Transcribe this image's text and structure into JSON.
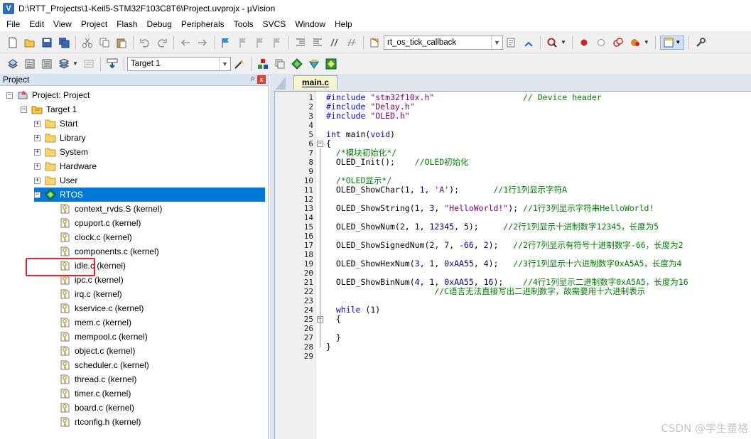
{
  "window": {
    "title": "D:\\RTT_Projects\\1-Keil5-STM32F103C8T6\\Project.uvprojx - µVision",
    "app_icon": "V"
  },
  "menu": [
    "File",
    "Edit",
    "View",
    "Project",
    "Flash",
    "Debug",
    "Peripherals",
    "Tools",
    "SVCS",
    "Window",
    "Help"
  ],
  "toolbar": {
    "find_combo": "rt_os_tick_callback",
    "target_combo": "Target 1"
  },
  "project_panel": {
    "title": "Project",
    "pin": "ᵖ",
    "close": "x",
    "tree": [
      {
        "label": "Project: Project",
        "icon": "project-icon",
        "expander": "−"
      },
      {
        "label": "Target 1",
        "icon": "target-folder-icon",
        "expander": "−"
      },
      {
        "label": "Start",
        "icon": "folder-icon",
        "expander": "+"
      },
      {
        "label": "Library",
        "icon": "folder-icon",
        "expander": "+"
      },
      {
        "label": "System",
        "icon": "folder-icon",
        "expander": "+"
      },
      {
        "label": "Hardware",
        "icon": "folder-icon",
        "expander": "+"
      },
      {
        "label": "User",
        "icon": "folder-icon",
        "expander": "+"
      },
      {
        "label": "RTOS",
        "icon": "component-icon",
        "expander": "−",
        "selected": true
      },
      {
        "label": "context_rvds.S (kernel)",
        "icon": "file-key-icon"
      },
      {
        "label": "cpuport.c (kernel)",
        "icon": "file-key-icon"
      },
      {
        "label": "clock.c (kernel)",
        "icon": "file-key-icon"
      },
      {
        "label": "components.c (kernel)",
        "icon": "file-key-icon"
      },
      {
        "label": "idle.c (kernel)",
        "icon": "file-key-icon"
      },
      {
        "label": "ipc.c (kernel)",
        "icon": "file-key-icon"
      },
      {
        "label": "irq.c (kernel)",
        "icon": "file-key-icon"
      },
      {
        "label": "kservice.c (kernel)",
        "icon": "file-key-icon"
      },
      {
        "label": "mem.c (kernel)",
        "icon": "file-key-icon"
      },
      {
        "label": "mempool.c (kernel)",
        "icon": "file-key-icon"
      },
      {
        "label": "object.c (kernel)",
        "icon": "file-key-icon"
      },
      {
        "label": "scheduler.c (kernel)",
        "icon": "file-key-icon"
      },
      {
        "label": "thread.c (kernel)",
        "icon": "file-key-icon"
      },
      {
        "label": "timer.c (kernel)",
        "icon": "file-key-icon"
      },
      {
        "label": "board.c (kernel)",
        "icon": "file-key-icon"
      },
      {
        "label": "rtconfig.h (kernel)",
        "icon": "file-key-icon"
      }
    ]
  },
  "editor": {
    "tab": "main.c",
    "lines": [
      {
        "n": "1",
        "t": [
          [
            "kw",
            "#include "
          ],
          [
            "str",
            "\"stm32f10x.h\""
          ],
          [
            "",
            "                  "
          ],
          [
            "cm",
            "// Device header"
          ]
        ]
      },
      {
        "n": "2",
        "t": [
          [
            "kw",
            "#include "
          ],
          [
            "str",
            "\"Delay.h\""
          ]
        ]
      },
      {
        "n": "3",
        "t": [
          [
            "kw",
            "#include "
          ],
          [
            "str",
            "\"OLED.h\""
          ]
        ]
      },
      {
        "n": "4",
        "t": []
      },
      {
        "n": "5",
        "t": [
          [
            "kw",
            "int"
          ],
          [
            "",
            " main("
          ],
          [
            "kw",
            "void"
          ],
          [
            "",
            ")"
          ]
        ]
      },
      {
        "n": "6",
        "t": [
          [
            "",
            "{"
          ]
        ],
        "fold": "−"
      },
      {
        "n": "7",
        "t": [
          [
            "",
            "  "
          ],
          [
            "cm",
            "/*模块初始化*/"
          ]
        ]
      },
      {
        "n": "8",
        "t": [
          [
            "",
            "  OLED_Init();    "
          ],
          [
            "cm",
            "//OLED初始化"
          ]
        ]
      },
      {
        "n": "9",
        "t": []
      },
      {
        "n": "10",
        "t": [
          [
            "",
            "  "
          ],
          [
            "cm",
            "/*OLED显示*/"
          ]
        ]
      },
      {
        "n": "11",
        "t": [
          [
            "",
            "  OLED_ShowChar("
          ],
          [
            "num",
            "1"
          ],
          [
            "",
            ", "
          ],
          [
            "num",
            "1"
          ],
          [
            "",
            ", "
          ],
          [
            "str",
            "'A'"
          ],
          [
            "",
            ");       "
          ],
          [
            "cm",
            "//1行1列显示字符A"
          ]
        ]
      },
      {
        "n": "12",
        "t": []
      },
      {
        "n": "13",
        "t": [
          [
            "",
            "  OLED_ShowString("
          ],
          [
            "num",
            "1"
          ],
          [
            "",
            ", "
          ],
          [
            "num",
            "3"
          ],
          [
            "",
            ", "
          ],
          [
            "str",
            "\"HelloWorld!\""
          ],
          [
            "",
            "); "
          ],
          [
            "cm",
            "//1行3列显示字符串HelloWorld!"
          ]
        ]
      },
      {
        "n": "14",
        "t": []
      },
      {
        "n": "15",
        "t": [
          [
            "",
            "  OLED_ShowNum("
          ],
          [
            "num",
            "2"
          ],
          [
            "",
            ", "
          ],
          [
            "num",
            "1"
          ],
          [
            "",
            ", "
          ],
          [
            "num",
            "12345"
          ],
          [
            "",
            ", "
          ],
          [
            "num",
            "5"
          ],
          [
            "",
            ");     "
          ],
          [
            "cm",
            "//2行1列显示十进制数字12345，长度为5"
          ]
        ]
      },
      {
        "n": "16",
        "t": []
      },
      {
        "n": "17",
        "t": [
          [
            "",
            "  OLED_ShowSignedNum("
          ],
          [
            "num",
            "2"
          ],
          [
            "",
            ", "
          ],
          [
            "num",
            "7"
          ],
          [
            "",
            ", "
          ],
          [
            "num",
            "-66"
          ],
          [
            "",
            ", "
          ],
          [
            "num",
            "2"
          ],
          [
            "",
            ");   "
          ],
          [
            "cm",
            "//2行7列显示有符号十进制数字-66，长度为2"
          ]
        ]
      },
      {
        "n": "18",
        "t": []
      },
      {
        "n": "19",
        "t": [
          [
            "",
            "  OLED_ShowHexNum("
          ],
          [
            "num",
            "3"
          ],
          [
            "",
            ", "
          ],
          [
            "num",
            "1"
          ],
          [
            "",
            ", "
          ],
          [
            "num",
            "0xAA55"
          ],
          [
            "",
            ", "
          ],
          [
            "num",
            "4"
          ],
          [
            "",
            ");   "
          ],
          [
            "cm",
            "//3行1列显示十六进制数字0xA5A5，长度为4"
          ]
        ]
      },
      {
        "n": "20",
        "t": []
      },
      {
        "n": "21",
        "t": [
          [
            "",
            "  OLED_ShowBinNum("
          ],
          [
            "num",
            "4"
          ],
          [
            "",
            ", "
          ],
          [
            "num",
            "1"
          ],
          [
            "",
            ", "
          ],
          [
            "num",
            "0xAA55"
          ],
          [
            "",
            ", "
          ],
          [
            "num",
            "16"
          ],
          [
            "",
            ");    "
          ],
          [
            "cm",
            "//4行1列显示二进制数字0xA5A5，长度为16"
          ]
        ]
      },
      {
        "n": "22",
        "t": [
          [
            "",
            "                      "
          ],
          [
            "cm",
            "//C语言无法直接写出二进制数字，故需要用十六进制表示"
          ]
        ]
      },
      {
        "n": "23",
        "t": []
      },
      {
        "n": "24",
        "t": [
          [
            "",
            "  "
          ],
          [
            "kw",
            "while"
          ],
          [
            "",
            " ("
          ],
          [
            "num",
            "1"
          ],
          [
            "",
            ")"
          ]
        ]
      },
      {
        "n": "25",
        "t": [
          [
            "",
            "  {"
          ]
        ],
        "fold": "−"
      },
      {
        "n": "26",
        "t": []
      },
      {
        "n": "27",
        "t": [
          [
            "",
            "  }"
          ]
        ]
      },
      {
        "n": "28",
        "t": [
          [
            "",
            "}"
          ]
        ]
      },
      {
        "n": "29",
        "t": []
      }
    ]
  },
  "watermark": "CSDN @学生董格"
}
